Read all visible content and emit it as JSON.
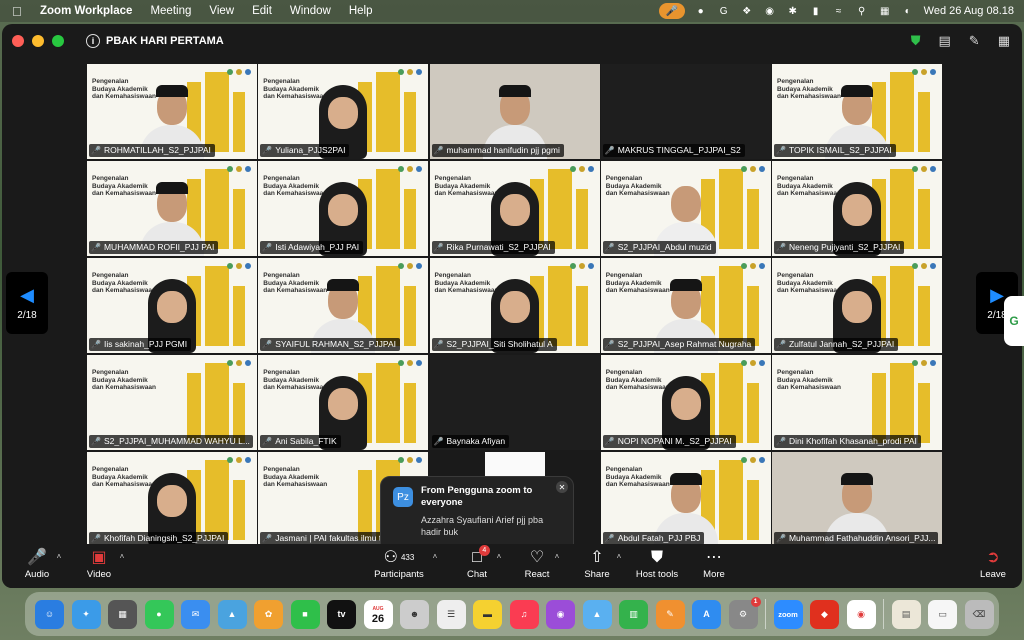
{
  "menubar": {
    "app_name": "Zoom Workplace",
    "menus": [
      "Meeting",
      "View",
      "Edit",
      "Window",
      "Help"
    ],
    "datetime": "Wed 26 Aug  08.18"
  },
  "window": {
    "meeting_title": "PBAK HARI PERTAMA"
  },
  "slide": {
    "line1": "Pengenalan",
    "line2": "Budaya Akademik",
    "line3": "dan Kemahasiswaan"
  },
  "participants": [
    {
      "name": "ROHMATILLAH_S2_PJJPAI"
    },
    {
      "name": "Yuliana_PJJS2PAI"
    },
    {
      "name": "muhammad hanifudin pjj pgmi"
    },
    {
      "name": "MAKRUS TINGGAL_PJJPAI_S2"
    },
    {
      "name": "TOPIK ISMAIL_S2_PJJPAI"
    },
    {
      "name": "MUHAMMAD ROFII_PJJ PAI"
    },
    {
      "name": "Isti Adawiyah_PJJ PAI"
    },
    {
      "name": "Rika Purnawati_S2_PJJPAI"
    },
    {
      "name": "S2_PJJPAI_Abdul muzid"
    },
    {
      "name": "Neneng Pujiyanti_S2_PJJPAI"
    },
    {
      "name": "Iis sakinah_PJJ PGMI"
    },
    {
      "name": "SYAIFUL RAHMAN_S2_PJJPAI"
    },
    {
      "name": "S2_PJJPAI_Siti Sholihatul A"
    },
    {
      "name": "S2_PJJPAI_Asep Rahmat Nugraha"
    },
    {
      "name": "Zulfatul Jannah_S2_PJJPAI"
    },
    {
      "name": "S2_PJJPAI_MUHAMMAD WAHYU L..."
    },
    {
      "name": "Ani Sabila_FTIK"
    },
    {
      "name": "Baynaka Afiyan"
    },
    {
      "name": "NOPI NOPANI M._S2_PJJPAI"
    },
    {
      "name": "Dini Khofifah Khasanah_prodi PAI"
    },
    {
      "name": "Khofifah Dianingsih_S2_PJJPAI"
    },
    {
      "name": "Jasmani | PAI fakultas ilmu t..."
    },
    {
      "name": ""
    },
    {
      "name": "Abdul Fatah_PJJ PBJ"
    },
    {
      "name": "Muhammad Fathahuddin Ansori_PJJ..."
    }
  ],
  "pager": {
    "left": "2/18",
    "right": "2/18"
  },
  "chat_popup": {
    "avatar": "Pz",
    "from": "From Pengguna zoom to everyone",
    "message": "Azzahra Syaufiani Arief pjj pba hadir buk"
  },
  "toolbar": {
    "audio": "Audio",
    "video": "Video",
    "participants": "Participants",
    "participants_count": "433",
    "chat": "Chat",
    "chat_badge": "4",
    "react": "React",
    "share": "Share",
    "host_tools": "Host tools",
    "more": "More",
    "leave": "Leave"
  },
  "dock": {
    "calendar_day": "26",
    "calendar_month": "AUG",
    "zoom_label": "zoom",
    "settings_badge": "1"
  },
  "colors": {
    "slide_gold": "#e6bd2a",
    "mute_red": "#e03b3b",
    "pager_arrow": "#1e8cff",
    "security_green": "#2fbf4a"
  }
}
